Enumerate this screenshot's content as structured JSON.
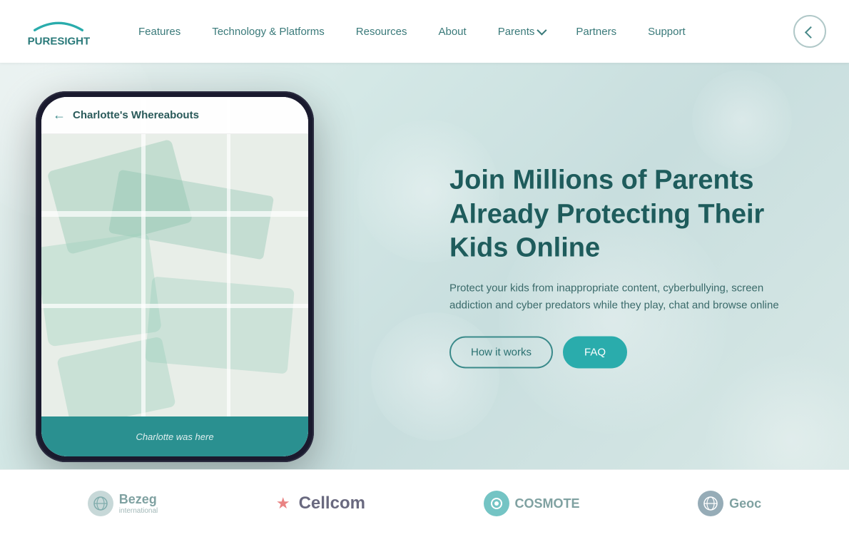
{
  "brand": {
    "name": "PURESIGHT",
    "logo_text": "PURESIGHT"
  },
  "nav": {
    "features": "Features",
    "tech_platforms": "Technology & Platforms",
    "resources": "Resources",
    "about": "About",
    "parents": "Parents",
    "partners": "Partners",
    "support": "Support"
  },
  "hero": {
    "title": "Join Millions of Parents Already Protecting Their Kids Online",
    "description": "Protect your kids from inappropriate content, cyberbullying, screen addiction and cyber predators while they play, chat and browse online",
    "btn_how": "How it works",
    "btn_faq": "FAQ"
  },
  "phone": {
    "screen_title": "Charlotte's Whereabouts",
    "bottom_text": "Charlotte was here"
  },
  "partners": [
    {
      "name": "Bezeg",
      "sub": "international",
      "icon": "globe"
    },
    {
      "name": "Cellcom",
      "sub": "",
      "icon": "star"
    },
    {
      "name": "COSMOTE",
      "sub": "",
      "icon": "circle"
    },
    {
      "name": "Geoc",
      "sub": "",
      "icon": "globe2"
    }
  ]
}
